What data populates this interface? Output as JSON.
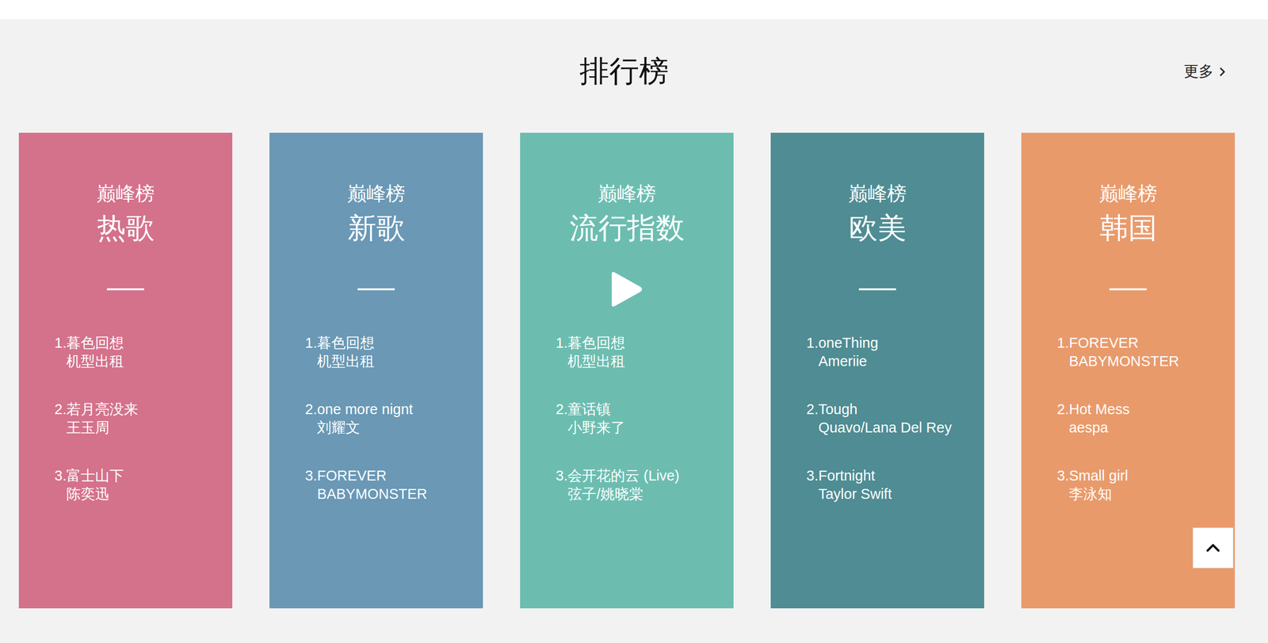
{
  "section": {
    "title": "排行榜",
    "more": "更多"
  },
  "charts": [
    {
      "label": "巅峰榜",
      "name": "热歌",
      "color": "#d4718b",
      "hovered": false,
      "songs": [
        {
          "rank": "1.",
          "title": "暮色回想",
          "artist": "机型出租"
        },
        {
          "rank": "2.",
          "title": "若月亮没来",
          "artist": "王玉周"
        },
        {
          "rank": "3.",
          "title": "富士山下",
          "artist": "陈奕迅"
        }
      ]
    },
    {
      "label": "巅峰榜",
      "name": "新歌",
      "color": "#6a98b5",
      "hovered": false,
      "songs": [
        {
          "rank": "1.",
          "title": "暮色回想",
          "artist": "机型出租"
        },
        {
          "rank": "2.",
          "title": "one more nignt",
          "artist": "刘耀文"
        },
        {
          "rank": "3.",
          "title": "FOREVER",
          "artist": "BABYMONSTER"
        }
      ]
    },
    {
      "label": "巅峰榜",
      "name": "流行指数",
      "color": "#6cbdb0",
      "hovered": true,
      "songs": [
        {
          "rank": "1.",
          "title": "暮色回想",
          "artist": "机型出租"
        },
        {
          "rank": "2.",
          "title": "童话镇",
          "artist": "小野来了"
        },
        {
          "rank": "3.",
          "title": "会开花的云 (Live)",
          "artist": "弦子/姚晓棠"
        }
      ]
    },
    {
      "label": "巅峰榜",
      "name": "欧美",
      "color": "#4f8c93",
      "hovered": false,
      "songs": [
        {
          "rank": "1.",
          "title": "oneThing",
          "artist": "Ameriie"
        },
        {
          "rank": "2.",
          "title": "Tough",
          "artist": "Quavo/Lana Del Rey"
        },
        {
          "rank": "3.",
          "title": "Fortnight",
          "artist": "Taylor Swift"
        }
      ]
    },
    {
      "label": "巅峰榜",
      "name": "韩国",
      "color": "#e99a6b",
      "hovered": false,
      "songs": [
        {
          "rank": "1.",
          "title": "FOREVER",
          "artist": "BABYMONSTER"
        },
        {
          "rank": "2.",
          "title": "Hot Mess",
          "artist": "aespa"
        },
        {
          "rank": "3.",
          "title": "Small girl",
          "artist": "李泳知"
        }
      ]
    }
  ]
}
